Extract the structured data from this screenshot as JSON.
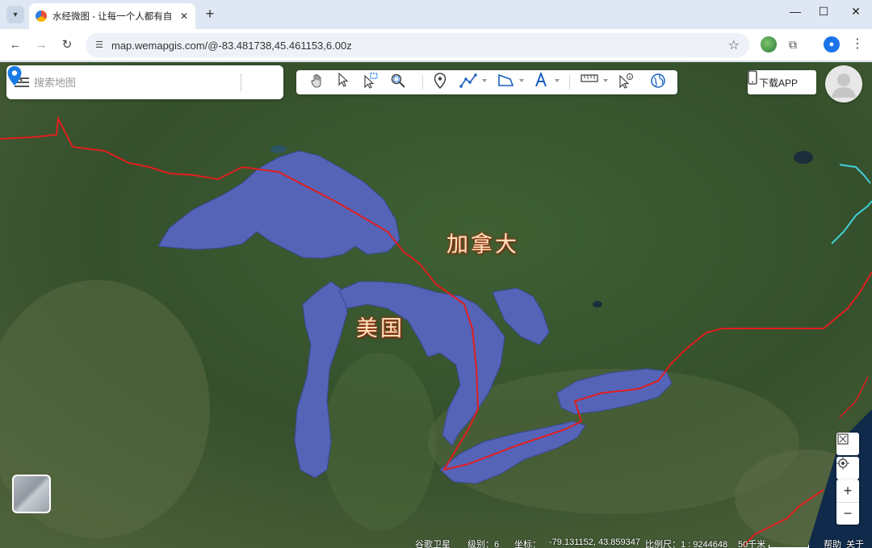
{
  "browser": {
    "tab_title": "水经微图 - 让每一个人都有自己",
    "url": "map.wemapgis.com/@-83.481738,45.461153,6.00z"
  },
  "search": {
    "placeholder": "搜索地图"
  },
  "header": {
    "download_label": "下载APP"
  },
  "map": {
    "labels": {
      "canada": "加拿大",
      "usa": "美国"
    },
    "colors": {
      "lake": "#5566b8",
      "border": "#e01e1e",
      "land": "#3d5a2f"
    }
  },
  "status": {
    "source": "谷歌卫星",
    "level": "级别：6",
    "coords_label": "坐标：",
    "coords": "-79.131152, 43.859347",
    "scale": "比例尺：1 : 9244648",
    "scale_bar": "50千米",
    "help": "帮助",
    "about": "关于"
  },
  "icons": [
    "tab-list-icon",
    "favicon-icon",
    "close-icon",
    "new-tab-icon",
    "minimize-icon",
    "maximize-icon",
    "back-icon",
    "forward-icon",
    "reload-icon",
    "site-info-icon",
    "star-icon",
    "extension-icon",
    "puzzle-icon",
    "profile-icon",
    "menu-icon",
    "hamburger-icon",
    "search-icon",
    "location-pin-icon",
    "hand-icon",
    "pointer-icon",
    "select-icon",
    "zoom-select-icon",
    "marker-icon",
    "polyline-icon",
    "polygon-icon",
    "text-icon",
    "ruler-icon",
    "info-pointer-icon",
    "globe-icon",
    "phone-icon",
    "avatar-icon",
    "layer-switch-icon",
    "fullscreen-icon",
    "locate-icon",
    "zoom-in-icon",
    "zoom-out-icon"
  ]
}
